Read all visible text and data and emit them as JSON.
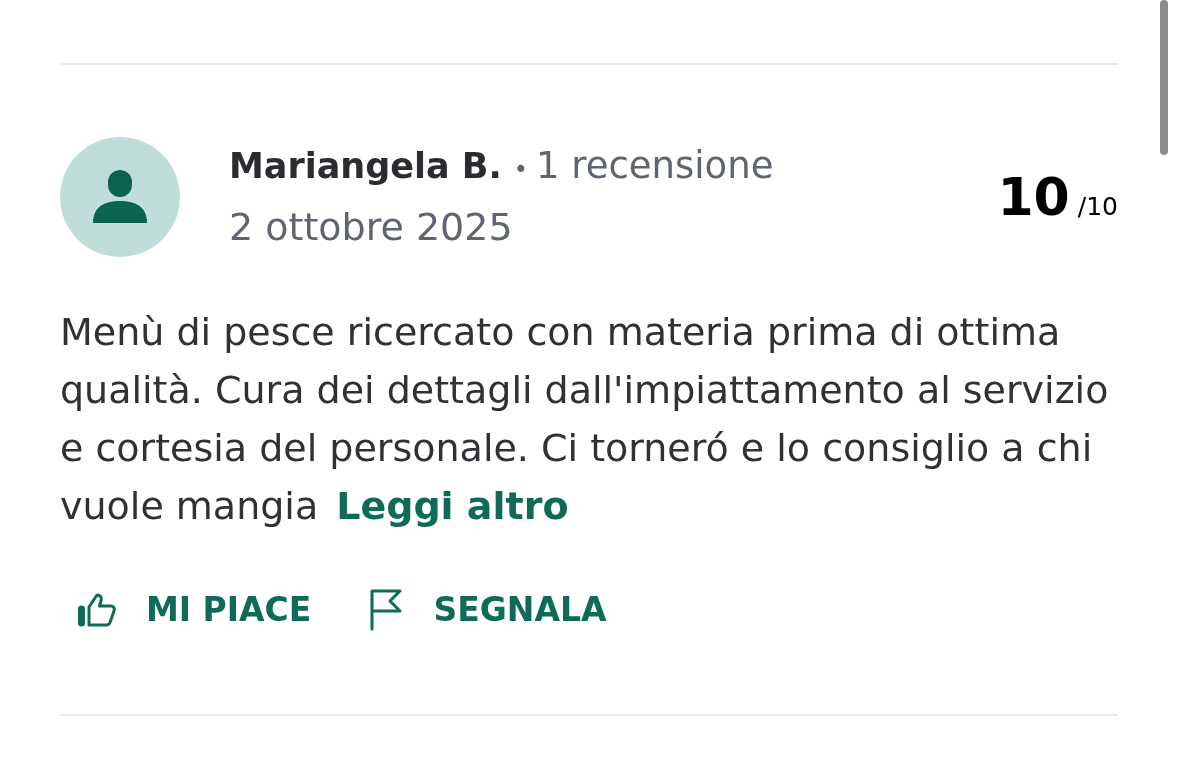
{
  "review": {
    "author": "Mariangela B.",
    "separator": "•",
    "review_count": "1 recensione",
    "date": "2 ottobre 2025",
    "score": "10",
    "score_max": "/10",
    "text": "Menù di pesce ricercato con materia prima di ottima qualità. Cura dei dettagli dall'impiattamento al servizio e cortesia del personale. Ci torneró e lo consiglio a chi vuole mangia",
    "read_more": "Leggi altro",
    "actions": [
      {
        "kind": "like",
        "label": "MI PIACE"
      },
      {
        "kind": "report",
        "label": "SEGNALA"
      }
    ]
  }
}
